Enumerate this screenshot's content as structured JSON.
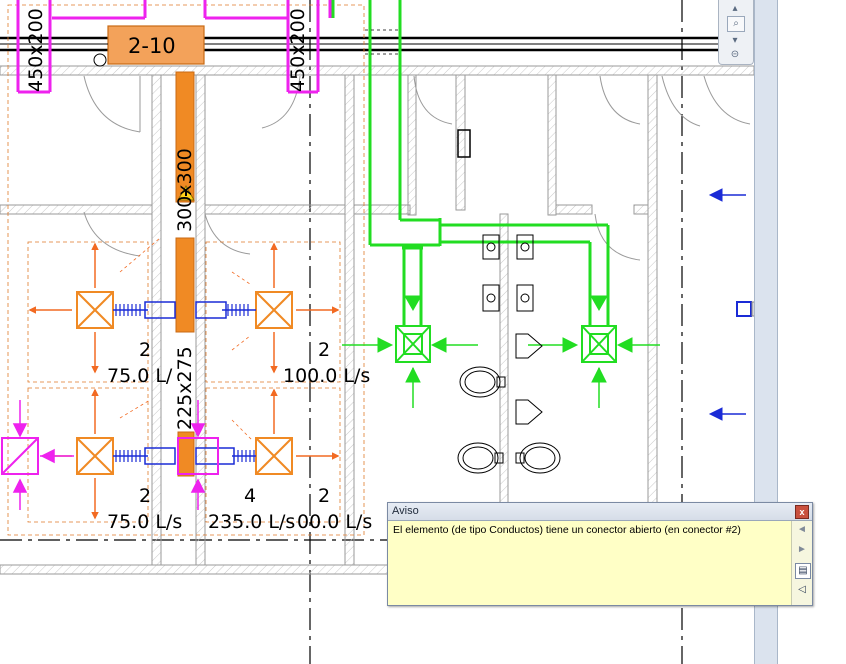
{
  "drawing": {
    "duct_tags": {
      "left_vertical": "450x200",
      "right_vertical": "450x200",
      "main_vertical_upper": "300x300",
      "main_vertical_lower": "225x275",
      "equipment_tag": "2-10"
    },
    "diffusers": [
      {
        "count": "2",
        "flow": "75.0 L/"
      },
      {
        "count": "2",
        "flow": "100.0 L/s"
      },
      {
        "count": "2",
        "flow": "75.0 L/s"
      },
      {
        "count": "4",
        "flow": "235.0 L/s"
      },
      {
        "count": "2",
        "flow": "00.0 L/s"
      }
    ],
    "colors": {
      "supply_duct": "#f08a24",
      "exhaust_duct": "#22dd22",
      "return_duct": "#ee22ee",
      "flex_duct": "#1a2bd6",
      "wall": "#9a9a9a",
      "flow_arrow": "#f26a22",
      "section_arrow": "#1a2bd6"
    }
  },
  "warning_dialog": {
    "title": "Aviso",
    "close_label": "x",
    "message": "El elemento (de tipo Conductos) tiene un conector abierto (en conector #2)",
    "buttons": {
      "previous": "◄",
      "next": "►",
      "details": "▤",
      "sound": "◁"
    }
  },
  "navigation": {
    "zoom_icon": "zoom-icon",
    "up_icon": "chevron-up-icon",
    "down_icon": "chevron-down-icon"
  }
}
